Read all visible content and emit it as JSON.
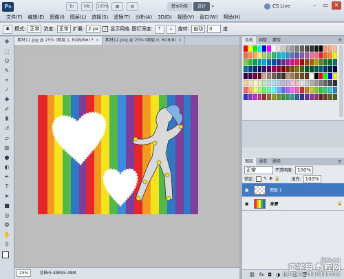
{
  "app": {
    "logo": "Ps"
  },
  "top_icons": [
    "Br",
    "Mb",
    "100%",
    "▦",
    "▤"
  ],
  "workspaces": {
    "basic": "基本功能",
    "design": "设计",
    "more": "»"
  },
  "cs_live": "CS Live",
  "window_controls": [
    "–",
    "▭",
    "✕"
  ],
  "menu": [
    "文件(F)",
    "编辑(E)",
    "图像(I)",
    "图层(L)",
    "选择(S)",
    "滤镜(T)",
    "分析(A)",
    "3D(D)",
    "视图(V)",
    "窗口(W)",
    "帮助(H)"
  ],
  "options": {
    "mode_label": "模式:",
    "mode_value": "正常",
    "density_label": "浓度:",
    "density_value": "正常",
    "spread_label": "扩展:",
    "spread_value": "2 px",
    "show_grid_label": "显示网格",
    "pin_depth_label": "图钉深度:",
    "rotate_label": "旋转:",
    "rotate_value": "自动",
    "angle_value": "0",
    "degree_label": "度"
  },
  "doc_tabs": [
    {
      "label": "素材11.jpg @ 25% (图层 1, RGB/8#) *",
      "close": "×"
    },
    {
      "label": "素材12.png @ 25% (图层 0, RGB/8)",
      "close": "×"
    }
  ],
  "status": {
    "zoom": "25%",
    "doc": "文档:5.49M/5.49M"
  },
  "swatch_tabs": {
    "color": "色板",
    "adjust": "调整",
    "masks": "蒙版"
  },
  "layers_panel": {
    "tabs": [
      "图层",
      "通道",
      "路径"
    ],
    "blend_mode": "正常",
    "opacity_label": "不透明度:",
    "opacity_value": "100%",
    "lock_label": "锁定:",
    "fill_label": "填充:",
    "fill_value": "100%",
    "layers": [
      {
        "name": "图层 1",
        "selected": true
      },
      {
        "name": "背景",
        "selected": false
      }
    ]
  },
  "watermark": {
    "line1": "查字典 教程网",
    "line2": "jiaocheng.chazidian.com",
    "site": "jb51.net"
  },
  "swatch_colors": [
    "#ff0000",
    "#ffff00",
    "#00ff00",
    "#00ffff",
    "#0000ff",
    "#ff00ff",
    "#ffffff",
    "#e6e6e6",
    "#cccccc",
    "#b3b3b3",
    "#999999",
    "#808080",
    "#666666",
    "#4d4d4d",
    "#333333",
    "#1a1a1a",
    "#000000",
    "#f7977a",
    "#f9ad81",
    "#fdc68a"
  ]
}
